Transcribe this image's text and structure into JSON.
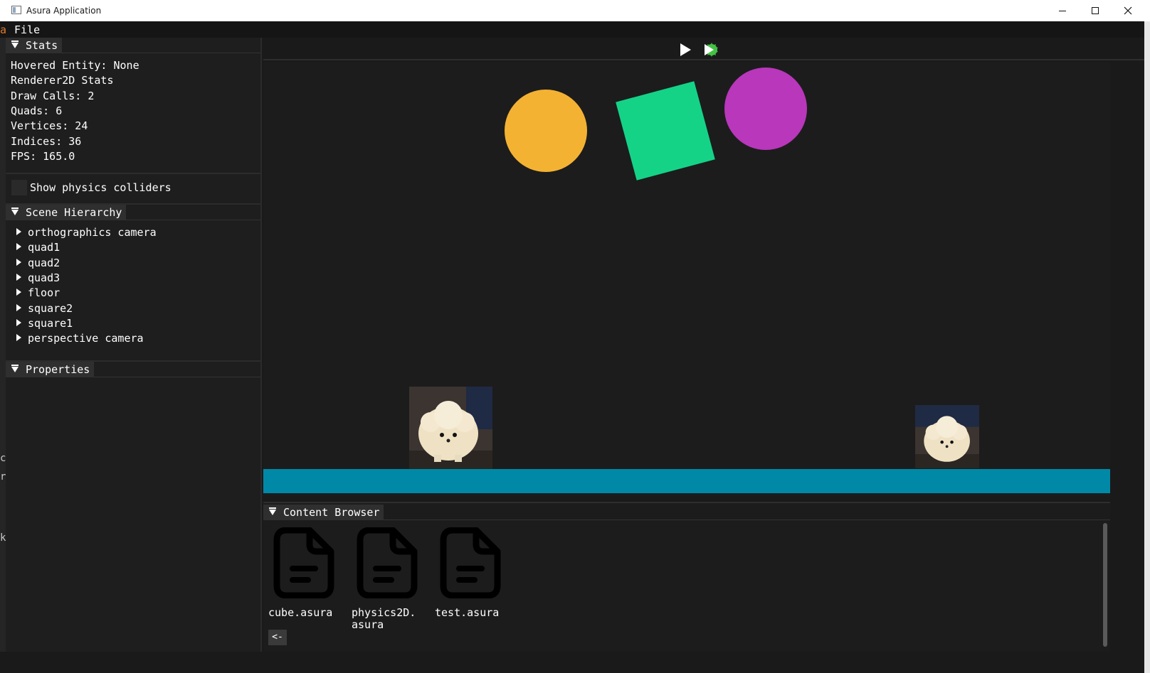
{
  "window": {
    "title": "Asura Application"
  },
  "menu": {
    "file": "File",
    "accent_char": "a"
  },
  "edge_chars": [
    "c",
    "r",
    "k"
  ],
  "stats": {
    "header": "Stats",
    "lines": [
      "Hovered Entity: None",
      "Renderer2D Stats",
      "Draw Calls: 2",
      "Quads: 6",
      "Vertices: 24",
      "Indices: 36",
      "FPS: 165.0"
    ]
  },
  "physics_colliders": {
    "label": "Show physics colliders",
    "checked": false
  },
  "scene_hierarchy": {
    "header": "Scene Hierarchy",
    "items": [
      "orthographics camera",
      "quad1",
      "quad2",
      "quad3",
      "floor",
      "square2",
      "square1",
      "perspective camera"
    ]
  },
  "properties": {
    "header": "Properties"
  },
  "toolbar": {
    "play_icon": "play-icon",
    "simulate_icon": "simulate-icon"
  },
  "scene": {
    "colors": {
      "orange": "#f4b233",
      "green": "#14d387",
      "magenta": "#b837bb",
      "floor": "#0089a7"
    }
  },
  "content_browser": {
    "header": "Content Browser",
    "files": [
      "cube.asura",
      "physics2D.\nasura",
      "test.asura"
    ],
    "back_label": "<-"
  }
}
